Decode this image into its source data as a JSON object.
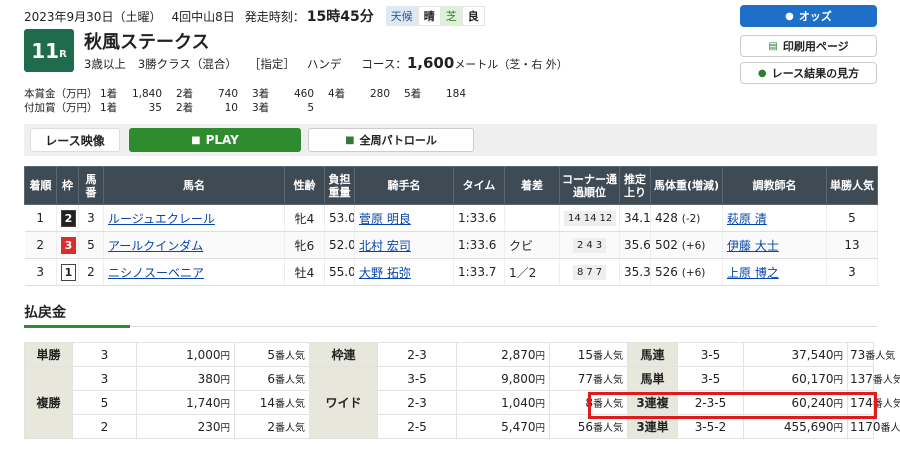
{
  "header": {
    "date": "2023年9月30日（土曜）",
    "meeting": "4回中山8日",
    "post_label": "発走時刻：",
    "post_time": "15時45分",
    "weather_label": "天候",
    "weather": "晴",
    "track_label": "芝",
    "track_condition": "良"
  },
  "race": {
    "number": "11",
    "r_suffix": "R",
    "name": "秋風ステークス",
    "conditions": [
      "3歳以上",
      "3勝クラス（混合）",
      "［指定］",
      "ハンデ"
    ],
    "course_label": "コース：",
    "distance": "1,600",
    "distance_unit": "メートル",
    "course_detail": "（芝・右 外）"
  },
  "prize": {
    "main_label": "本賞金（万円）",
    "main": [
      [
        "1着",
        "1,840"
      ],
      [
        "2着",
        "740"
      ],
      [
        "3着",
        "460"
      ],
      [
        "4着",
        "280"
      ],
      [
        "5着",
        "184"
      ]
    ],
    "extra_label": "付加賞（万円）",
    "extra": [
      [
        "1着",
        "35"
      ],
      [
        "2着",
        "10"
      ],
      [
        "3着",
        "5"
      ]
    ]
  },
  "buttons": {
    "odds": "オッズ",
    "print": "印刷用ページ",
    "view_guide": "レース結果の見方"
  },
  "video": {
    "label": "レース映像",
    "play": "PLAY",
    "patrol": "全周パトロール"
  },
  "results": {
    "headers": [
      "着順",
      "枠",
      "馬番",
      "馬名",
      "性齢",
      "負担重量",
      "騎手名",
      "タイム",
      "着差",
      "コーナー通過順位",
      "推定上り",
      "馬体重(増減)",
      "調教師名",
      "単勝人気"
    ],
    "rows": [
      {
        "rank": "1",
        "waku": "2",
        "num": "3",
        "horse": "ルージュエクレール",
        "sex_age": "牝4",
        "weight": "53.0",
        "jockey": "菅原 明良",
        "time": "1:33.6",
        "margin": "",
        "corner": [
          "14",
          "14",
          "12"
        ],
        "last3f": "34.1",
        "body": "428",
        "body_diff": "(-2)",
        "trainer": "萩原 清",
        "pop": "5"
      },
      {
        "rank": "2",
        "waku": "3",
        "num": "5",
        "horse": "アールクインダム",
        "sex_age": "牝6",
        "weight": "52.0",
        "jockey": "北村 宏司",
        "time": "1:33.6",
        "margin": "クビ",
        "corner": [
          "2",
          "4",
          "3"
        ],
        "last3f": "35.6",
        "body": "502",
        "body_diff": "(+6)",
        "trainer": "伊藤 大士",
        "pop": "13"
      },
      {
        "rank": "3",
        "waku": "1",
        "num": "2",
        "horse": "ニシノスーベニア",
        "sex_age": "牡4",
        "weight": "55.0",
        "jockey": "大野 拓弥",
        "time": "1:33.7",
        "margin": "1／2",
        "corner": [
          "8",
          "7",
          "7"
        ],
        "last3f": "35.3",
        "body": "526",
        "body_diff": "(+6)",
        "trainer": "上原 博之",
        "pop": "3"
      }
    ]
  },
  "payout": {
    "title": "払戻金",
    "yen": "円",
    "ninki": "番人気",
    "tansho": {
      "label": "単勝",
      "num": "3",
      "pay": "1,000",
      "pop": "5"
    },
    "fukusho": {
      "label": "複勝",
      "rows": [
        {
          "num": "3",
          "pay": "380",
          "pop": "6"
        },
        {
          "num": "5",
          "pay": "1,740",
          "pop": "14"
        },
        {
          "num": "2",
          "pay": "230",
          "pop": "2"
        }
      ]
    },
    "wakuren": {
      "label": "枠連",
      "num": "2-3",
      "pay": "2,870",
      "pop": "15"
    },
    "wide": {
      "label": "ワイド",
      "rows": [
        {
          "num": "3-5",
          "pay": "9,800",
          "pop": "77"
        },
        {
          "num": "2-3",
          "pay": "1,040",
          "pop": "8"
        },
        {
          "num": "2-5",
          "pay": "5,470",
          "pop": "56"
        }
      ]
    },
    "umaren": {
      "label": "馬連",
      "num": "3-5",
      "pay": "37,540",
      "pop": "73"
    },
    "umatan": {
      "label": "馬単",
      "num": "3-5",
      "pay": "60,170",
      "pop": "137"
    },
    "sanrenpuku": {
      "label": "3連複",
      "num": "2-3-5",
      "pay": "60,240",
      "pop": "174"
    },
    "sanrentan": {
      "label": "3連単",
      "num": "3-5-2",
      "pay": "455,690",
      "pop": "1170"
    }
  }
}
